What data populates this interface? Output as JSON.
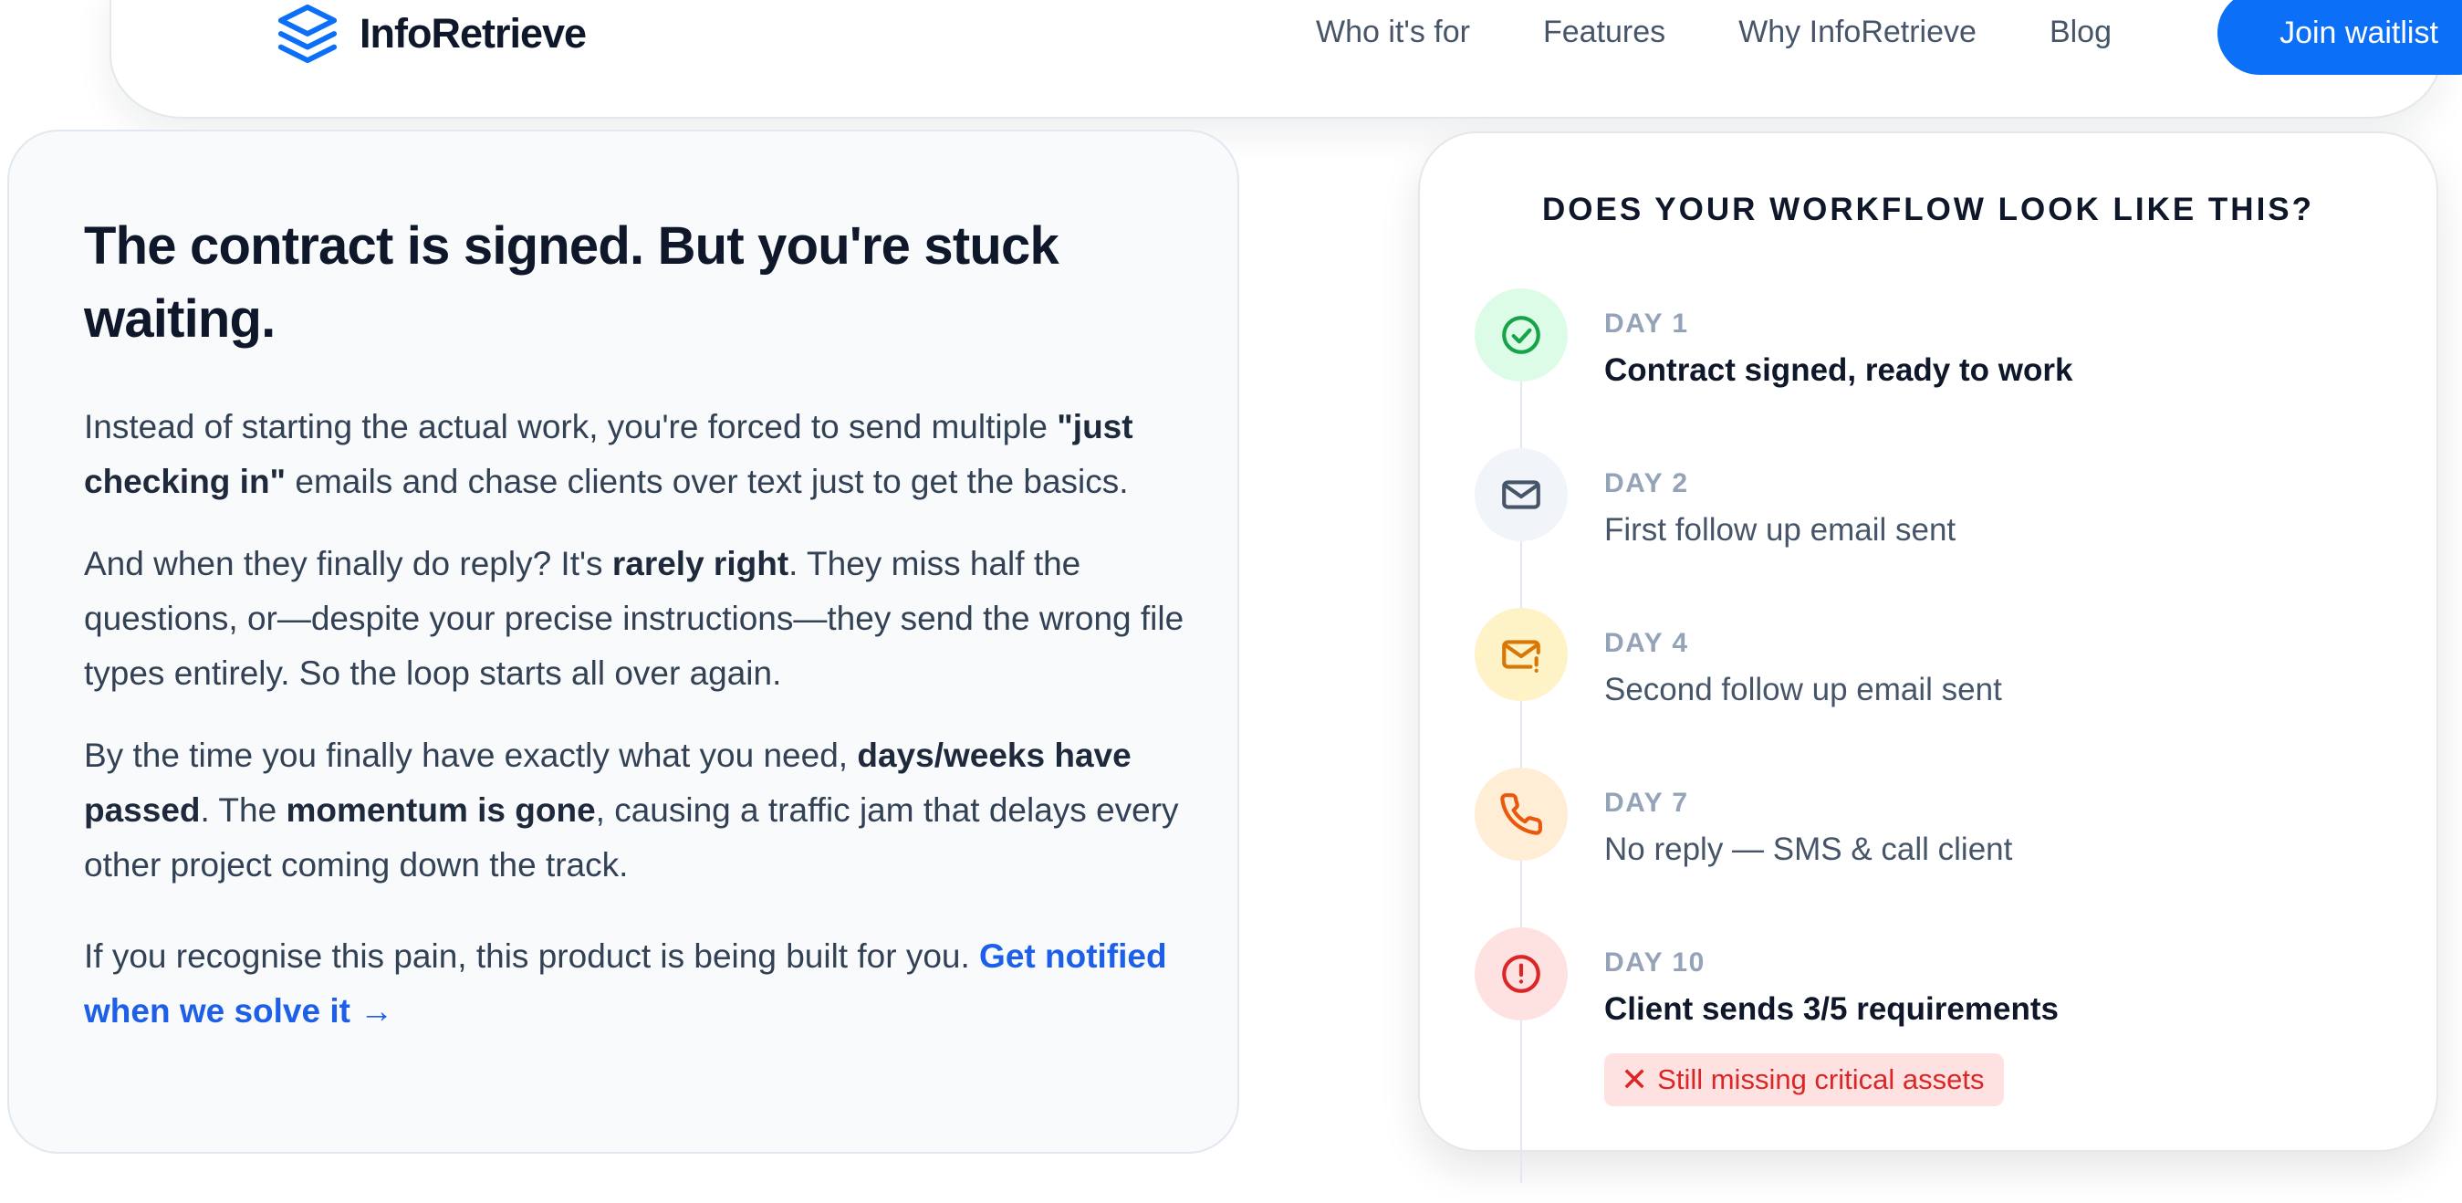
{
  "nav": {
    "brand": "InfoRetrieve",
    "links": [
      "Who it's for",
      "Features",
      "Why InfoRetrieve",
      "Blog"
    ],
    "cta": "Join waitlist"
  },
  "left": {
    "title": "The contract is signed. But you're stuck waiting.",
    "p1": {
      "a": "Instead of starting the actual work, you're forced to send multiple ",
      "b": "\"just checking in\"",
      "c": " emails and chase clients over text just to get the basics."
    },
    "p2": {
      "a": "And when they finally do reply? It's ",
      "b": "rarely right",
      "c": ". They miss half the questions, or—despite your precise instructions—they send the wrong file types entirely. So the loop starts all over again."
    },
    "p3": {
      "a": "By the time you finally have exactly what you need, ",
      "b": "days/weeks have passed",
      "c": ". The ",
      "d": "momentum is gone",
      "e": ", causing a traffic jam that delays every other project coming down the track."
    },
    "p4": {
      "a": "If you recognise this pain, this product is being built for you. ",
      "link": "Get notified when we solve it →"
    }
  },
  "workflow": {
    "heading": "DOES YOUR WORKFLOW LOOK LIKE THIS?",
    "steps": [
      {
        "day": "DAY 1",
        "text": "Contract signed, ready to work",
        "icon": "check-circle-icon",
        "bg": "#dcfce7",
        "color": "#16a34a"
      },
      {
        "day": "DAY 2",
        "text": "First follow up email sent",
        "icon": "mail-icon",
        "bg": "#f1f5f9",
        "color": "#475569"
      },
      {
        "day": "DAY 4",
        "text": "Second follow up email sent",
        "icon": "mail-alert-icon",
        "bg": "#fef3c7",
        "color": "#d97706"
      },
      {
        "day": "DAY 7",
        "text": "No reply — SMS & call client",
        "icon": "phone-icon",
        "bg": "#ffedd5",
        "color": "#ea580c"
      },
      {
        "day": "DAY 10",
        "text": "Client sends 3/5 requirements",
        "icon": "alert-circle-icon",
        "bg": "#fee2e2",
        "color": "#dc2626"
      }
    ],
    "warning": "Still missing critical assets"
  },
  "colors": {
    "accent": "#0b6ff7",
    "link": "#1d5fe8",
    "danger": "#dc2626"
  }
}
